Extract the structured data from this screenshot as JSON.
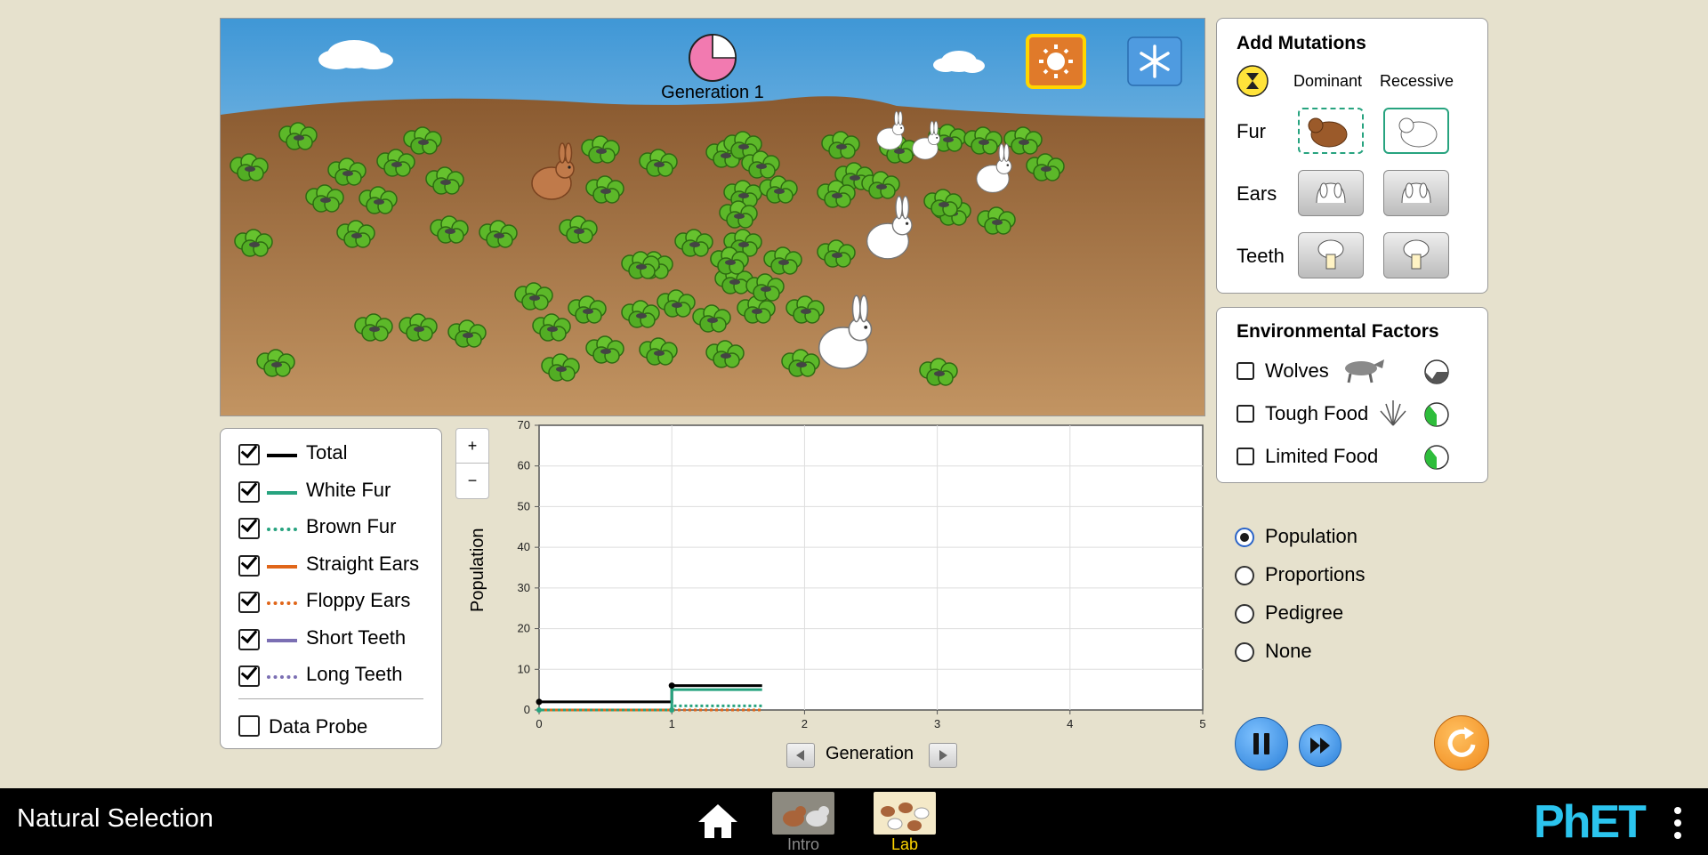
{
  "scene": {
    "generation_label": "Generation 1",
    "generation_clock_fraction": 0.75
  },
  "add_mutations": {
    "title": "Add Mutations",
    "col_dominant": "Dominant",
    "col_recessive": "Recessive",
    "rows": [
      {
        "label": "Fur"
      },
      {
        "label": "Ears"
      },
      {
        "label": "Teeth"
      }
    ]
  },
  "environmental_factors": {
    "title": "Environmental Factors",
    "items": [
      {
        "label": "Wolves",
        "checked": false
      },
      {
        "label": "Tough Food",
        "checked": false
      },
      {
        "label": "Limited Food",
        "checked": false
      }
    ]
  },
  "legend": {
    "items": [
      {
        "label": "Total",
        "checked": true,
        "color": "#000000",
        "style": "solid"
      },
      {
        "label": "White Fur",
        "checked": true,
        "color": "#27a37f",
        "style": "solid"
      },
      {
        "label": "Brown Fur",
        "checked": true,
        "color": "#27a37f",
        "style": "dotted"
      },
      {
        "label": "Straight Ears",
        "checked": true,
        "color": "#e0661a",
        "style": "solid"
      },
      {
        "label": "Floppy Ears",
        "checked": true,
        "color": "#e0661a",
        "style": "dotted"
      },
      {
        "label": "Short Teeth",
        "checked": true,
        "color": "#7b6fb3",
        "style": "solid"
      },
      {
        "label": "Long Teeth",
        "checked": true,
        "color": "#7b6fb3",
        "style": "dotted"
      }
    ],
    "data_probe": {
      "label": "Data Probe",
      "checked": false
    }
  },
  "zoom": {
    "in": "+",
    "out": "−"
  },
  "graph_view": {
    "options": [
      "Population",
      "Proportions",
      "Pedigree",
      "None"
    ],
    "selected": "Population"
  },
  "chart_data": {
    "type": "line",
    "xlabel": "Generation",
    "ylabel": "Population",
    "xlim": [
      0,
      5
    ],
    "ylim": [
      0,
      70
    ],
    "x_ticks": [
      "0",
      "1",
      "2",
      "3",
      "4",
      "5"
    ],
    "y_ticks": [
      "0",
      "10",
      "20",
      "30",
      "40",
      "50",
      "60",
      "70"
    ],
    "grid": true,
    "series": [
      {
        "name": "Total",
        "color": "#000000",
        "style": "solid",
        "points": [
          [
            0,
            2
          ],
          [
            1,
            2
          ],
          [
            1,
            6
          ],
          [
            1.68,
            6
          ]
        ]
      },
      {
        "name": "White Fur",
        "color": "#27a37f",
        "style": "solid",
        "points": [
          [
            0,
            0
          ],
          [
            1,
            0
          ],
          [
            1,
            5
          ],
          [
            1.68,
            5
          ]
        ]
      },
      {
        "name": "Brown Fur",
        "color": "#27a37f",
        "style": "dotted",
        "points": [
          [
            0,
            0
          ],
          [
            1,
            0
          ],
          [
            1,
            1
          ],
          [
            1.68,
            1
          ]
        ]
      },
      {
        "name": "Floppy Ears",
        "color": "#e0661a",
        "style": "dotted",
        "points": [
          [
            0,
            0
          ],
          [
            1,
            0
          ],
          [
            1.68,
            0
          ]
        ]
      }
    ]
  },
  "navbar": {
    "title": "Natural Selection",
    "screens": [
      {
        "label": "Intro",
        "active": false
      },
      {
        "label": "Lab",
        "active": true
      }
    ],
    "brand": "PhET"
  },
  "colors": {
    "background": "#e6e1cd",
    "sky_top": "#4a9fd8",
    "ground": "#a06b3b",
    "accent_orange": "#f08a1c",
    "accent_yellow": "#ffd500",
    "button_blue": "#4f9be0"
  }
}
